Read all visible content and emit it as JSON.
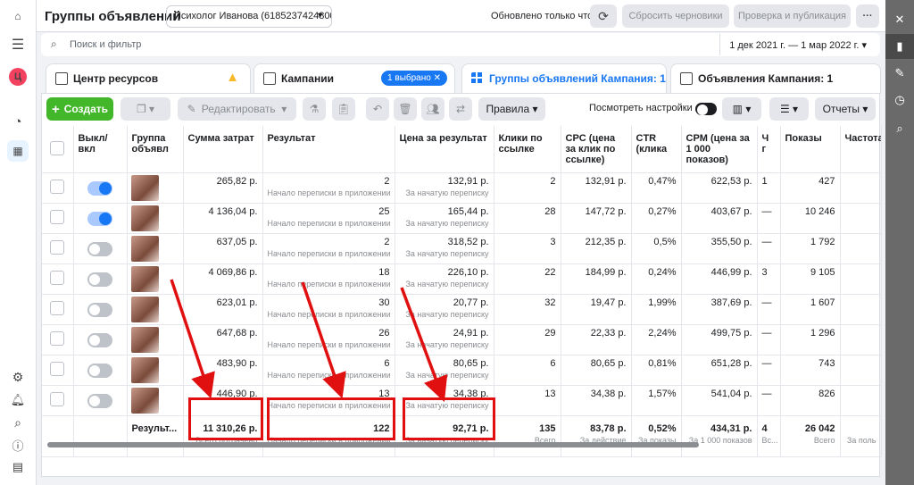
{
  "leftnav": {
    "avatar_letter": "Ц"
  },
  "header": {
    "title": "Группы объявлений",
    "account": "Психолог Иванова (61852374248005...",
    "updated_only": "Обновлено только что",
    "discard_label": "Сбросить черновики",
    "review_label": "Проверка и публикация",
    "more_label": "···"
  },
  "search": {
    "placeholder": "Поиск и фильтр",
    "date_range": "1 дек 2021 г. — 1 мар 2022 г."
  },
  "tabs": [
    {
      "label": "Центр ресурсов"
    },
    {
      "label": "Кампании",
      "badge": "1 выбрано"
    },
    {
      "label": "Группы объявлений Кампания: 1"
    },
    {
      "label": "Объявления Кампания: 1"
    }
  ],
  "toolbar": {
    "create_label": "Создать",
    "edit_label": "Редактировать",
    "rules_label": "Правила",
    "view_setup_label": "Посмотреть настройки",
    "reports_label": "Отчеты"
  },
  "columns": [
    "Выкл/вкл",
    "Группа объявл",
    "Сумма затрат",
    "Результат",
    "Цена за результат",
    "Клики по ссылке",
    "CPC (цена за клик по ссылке)",
    "CTR (клика",
    "CPM (цена за 1 000 показов)",
    "Ч г",
    "Показы",
    "Частота"
  ],
  "rows": [
    {
      "on": true,
      "spend": "265,82 р.",
      "result": "2",
      "result_sub": "Начало переписки в приложении",
      "cost": "132,91 р.",
      "cost_sub": "За начатую переписку",
      "clicks": "2",
      "cpc": "132,91 р.",
      "ctr": "0,47%",
      "cpm": "622,53 р.",
      "f": "1",
      "impr": "427"
    },
    {
      "on": true,
      "spend": "4 136,04 р.",
      "result": "25",
      "result_sub": "Начало переписки в приложении",
      "cost": "165,44 р.",
      "cost_sub": "За начатую переписку",
      "clicks": "28",
      "cpc": "147,72 р.",
      "ctr": "0,27%",
      "cpm": "403,67 р.",
      "f": "—",
      "impr": "10 246"
    },
    {
      "on": false,
      "spend": "637,05 р.",
      "result": "2",
      "result_sub": "Начало переписки в приложении",
      "cost": "318,52 р.",
      "cost_sub": "За начатую переписку",
      "clicks": "3",
      "cpc": "212,35 р.",
      "ctr": "0,5%",
      "cpm": "355,50 р.",
      "f": "—",
      "impr": "1 792"
    },
    {
      "on": false,
      "spend": "4 069,86 р.",
      "result": "18",
      "result_sub": "Начало переписки в приложении",
      "cost": "226,10 р.",
      "cost_sub": "За начатую переписку",
      "clicks": "22",
      "cpc": "184,99 р.",
      "ctr": "0,24%",
      "cpm": "446,99 р.",
      "f": "3",
      "impr": "9 105"
    },
    {
      "on": false,
      "spend": "623,01 р.",
      "result": "30",
      "result_sub": "Начало переписки в приложении",
      "cost": "20,77 р.",
      "cost_sub": "За начатую переписку",
      "clicks": "32",
      "cpc": "19,47 р.",
      "ctr": "1,99%",
      "cpm": "387,69 р.",
      "f": "—",
      "impr": "1 607"
    },
    {
      "on": false,
      "spend": "647,68 р.",
      "result": "26",
      "result_sub": "Начало переписки в приложении",
      "cost": "24,91 р.",
      "cost_sub": "За начатую переписку",
      "clicks": "29",
      "cpc": "22,33 р.",
      "ctr": "2,24%",
      "cpm": "499,75 р.",
      "f": "—",
      "impr": "1 296"
    },
    {
      "on": false,
      "spend": "483,90 р.",
      "result": "6",
      "result_sub": "Начало переписки в приложении",
      "cost": "80,65 р.",
      "cost_sub": "За начатую переписку",
      "clicks": "6",
      "cpc": "80,65 р.",
      "ctr": "0,81%",
      "cpm": "651,28 р.",
      "f": "—",
      "impr": "743"
    },
    {
      "on": false,
      "spend": "446,90 р.",
      "result": "13",
      "result_sub": "Начало переписки в приложении",
      "cost": "34,38 р.",
      "cost_sub": "За начатую переписку",
      "clicks": "13",
      "cpc": "34,38 р.",
      "ctr": "1,57%",
      "cpm": "541,04 р.",
      "f": "—",
      "impr": "826"
    }
  ],
  "totals": {
    "label": "Результ...",
    "spend": "11 310,26 р.",
    "spend_sub": "Всего потрачено",
    "result": "122",
    "result_sub": "Начало переписки в приложении",
    "cost": "92,71 р.",
    "cost_sub": "За начатую переписку",
    "clicks": "135",
    "clicks_sub": "Всего",
    "cpc": "83,78 р.",
    "cpc_sub": "За действие",
    "ctr": "0,52%",
    "ctr_sub": "За показы",
    "cpm": "434,31 р.",
    "cpm_sub": "За 1 000 показов",
    "f": "4",
    "f_sub": "Вс...",
    "impr": "26 042",
    "impr_sub": "Всего",
    "freq_sub": "За поль"
  },
  "colors": {
    "accent": "#1877f2",
    "create": "#42b72a",
    "highlight": "#e01010"
  }
}
